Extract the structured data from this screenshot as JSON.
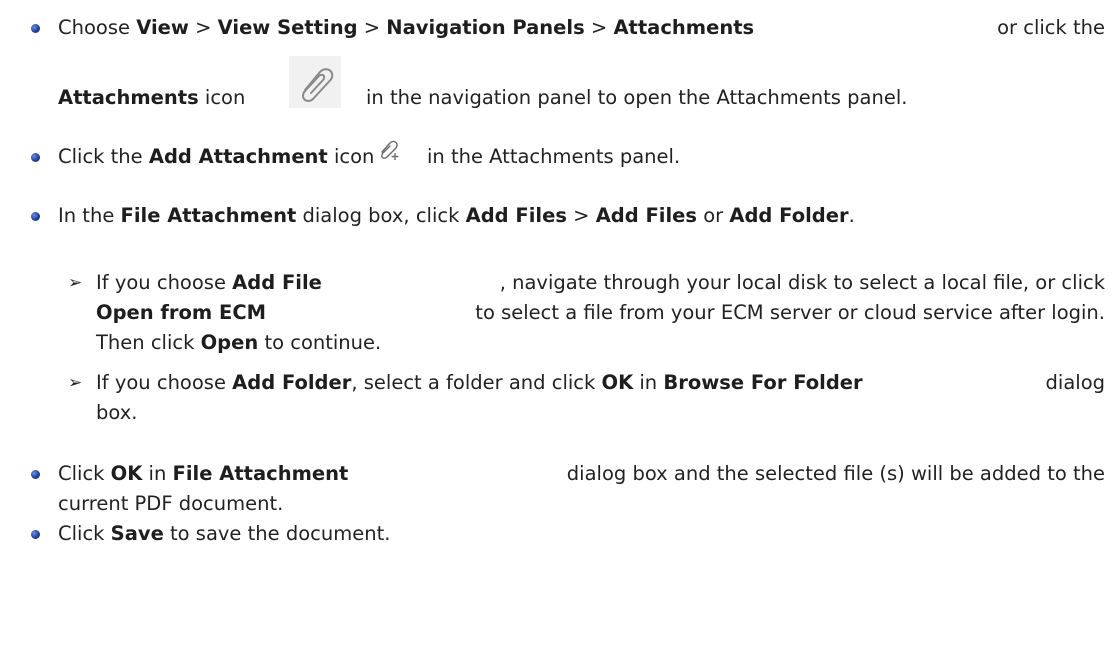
{
  "steps": [
    {
      "line1": {
        "t1": "Choose ",
        "b1": "View",
        "t2": " > ",
        "b2": "View Setting",
        "t3": " > ",
        "b3": "Navigation Panels",
        "t4": " > ",
        "b4": "Attachments",
        "t5": " or click the"
      },
      "line2": {
        "b1": "Attachments",
        "t1": " icon",
        "t2": "in the navigation panel to open the Attachments panel."
      },
      "icon": "paperclip-icon"
    },
    {
      "t1": "Click the ",
      "b1": "Add Attachment",
      "t2": " icon",
      "t3": "in the Attachments panel.",
      "icon": "add-attachment-icon"
    },
    {
      "t1": "In the ",
      "b1": "File Attachment",
      "t2": " dialog box, click ",
      "b2": "Add Files",
      "t3": " > ",
      "b3": "Add Files",
      "t4": " or ",
      "b4": "Add Folder",
      "t5": "."
    },
    {
      "line1": {
        "t1": "Click ",
        "b1": "OK",
        "t2": " in ",
        "b2": "File Attachment",
        "t3": " dialog box and the selected file (s) will be added to the"
      },
      "line2": "current PDF document."
    },
    {
      "t1": "Click ",
      "b1": "Save",
      "t2": " to save the document."
    }
  ],
  "substeps": [
    {
      "line1": {
        "t1": "If you choose ",
        "b1": "Add File",
        "t2": ", navigate through your local disk to select a local file, or click"
      },
      "line2": {
        "b1": "Open from ECM",
        "t1": " to select a file from your ECM server or cloud service after login."
      },
      "line3": {
        "t1": "Then click ",
        "b1": "Open",
        "t2": " to continue."
      }
    },
    {
      "line1": {
        "t1": "If you choose ",
        "b1": "Add Folder",
        "t2": ", select a folder and click ",
        "b2": "OK",
        "t3": " in ",
        "b3": "Browse For Folder",
        "t4": " dialog"
      },
      "line2": "box."
    }
  ],
  "arrow_glyph": "➢"
}
